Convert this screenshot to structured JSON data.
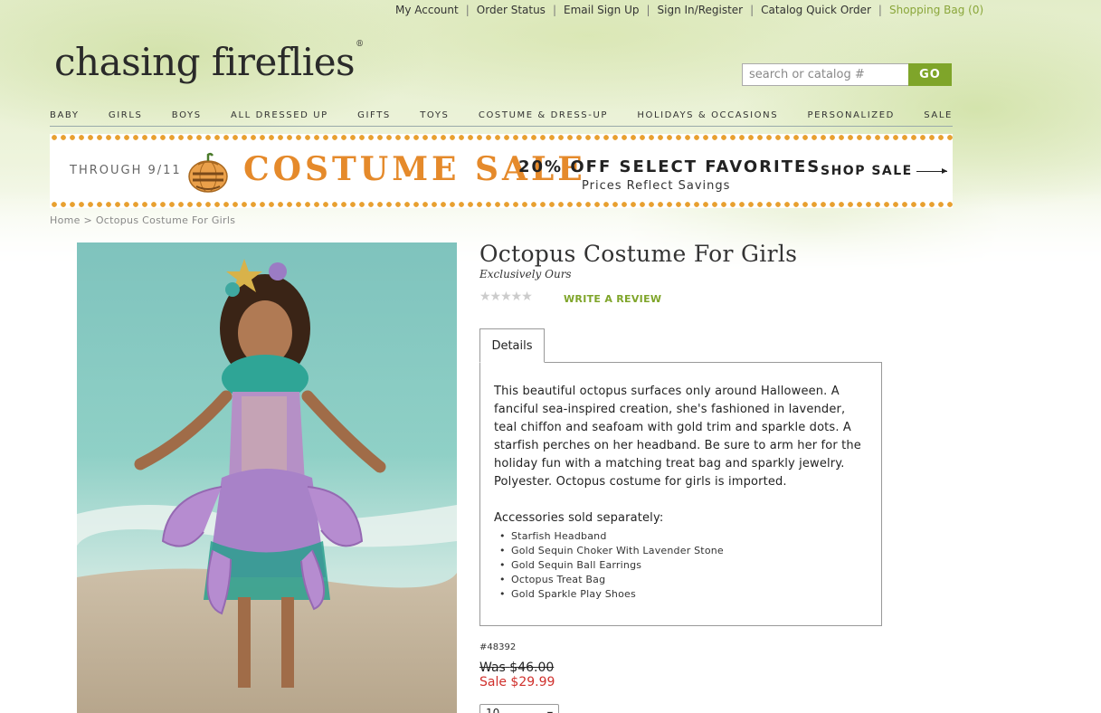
{
  "top_nav": {
    "my_account": "My Account",
    "order_status": "Order Status",
    "email_signup": "Email Sign Up",
    "sign_in": "Sign In/Register",
    "catalog_quick_order": "Catalog Quick Order",
    "shopping_bag": "Shopping Bag (0)"
  },
  "logo": {
    "text": "chasing fireflies",
    "mark": "®"
  },
  "search": {
    "placeholder": "search or catalog #",
    "button": "GO"
  },
  "main_nav": [
    "BABY",
    "GIRLS",
    "BOYS",
    "ALL DRESSED UP",
    "GIFTS",
    "TOYS",
    "COSTUME & DRESS-UP",
    "HOLIDAYS & OCCASIONS",
    "PERSONALIZED",
    "SALE"
  ],
  "banner": {
    "through": "THROUGH 9/11",
    "headline": "COSTUME SALE",
    "offer": "20% OFF SELECT FAVORITES",
    "subline": "Prices Reflect Savings",
    "cta": "SHOP SALE"
  },
  "breadcrumb": {
    "home": "Home",
    "separator": ">",
    "current": "Octopus Costume For Girls"
  },
  "product": {
    "title": "Octopus Costume For Girls",
    "subtitle": "Exclusively Ours",
    "stars": "★★★★★",
    "write_review": "WRITE A REVIEW",
    "tab_label": "Details",
    "description": "This beautiful octopus surfaces only around Halloween. A fanciful sea-inspired creation, she's fashioned in lavender, teal chiffon and seafoam with gold trim and sparkle dots. A starfish perches on her headband. Be sure to arm her for the holiday fun with a matching treat bag and sparkly jewelry. Polyester. Octopus costume for girls is imported.",
    "accessories_heading": "Accessories sold separately:",
    "accessories": [
      "Starfish Headband",
      "Gold Sequin Choker With Lavender Stone",
      "Gold Sequin Ball Earrings",
      "Octopus Treat Bag",
      "Gold Sparkle Play Shoes"
    ],
    "sku": "#48392",
    "was_label": "Was",
    "was_price": "$46.00",
    "sale_label": "Sale",
    "sale_price": "$29.99",
    "size_selected": "10"
  },
  "colors": {
    "brand_green": "#7fa52a",
    "sale_red": "#d0312d",
    "banner_orange": "#e58a2b"
  }
}
